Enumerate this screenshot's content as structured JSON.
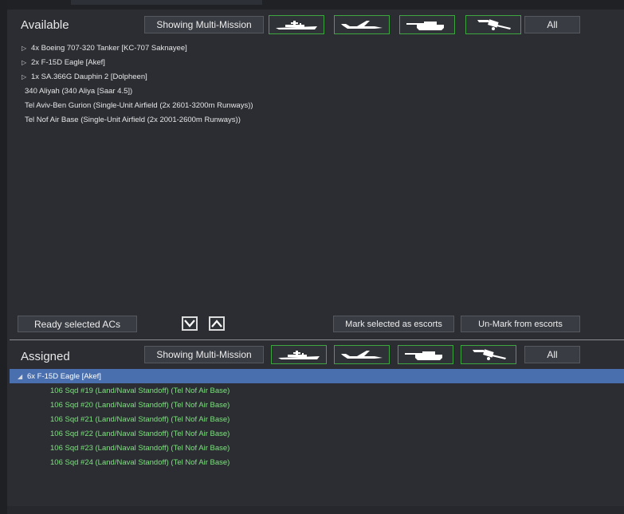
{
  "available": {
    "title": "Available",
    "filter_button": "Showing Multi-Mission",
    "type_filters": [
      {
        "name": "ship-filter-icon"
      },
      {
        "name": "aircraft-filter-icon"
      },
      {
        "name": "tank-filter-icon"
      },
      {
        "name": "satellite-filter-icon"
      }
    ],
    "all_button": "All",
    "items": [
      {
        "label": "4x Boeing 707-320 Tanker [KC-707 Saknayee]",
        "expandable": true
      },
      {
        "label": "2x F-15D Eagle [Akef]",
        "expandable": true
      },
      {
        "label": "1x SA.366G Dauphin 2 [Dolpheen]",
        "expandable": true
      },
      {
        "label": "340 Aliyah (340 Aliya [Saar 4.5])",
        "expandable": false
      },
      {
        "label": "Tel Aviv-Ben Gurion (Single-Unit Airfield (2x 2601-3200m Runways))",
        "expandable": false
      },
      {
        "label": "Tel Nof Air Base (Single-Unit Airfield (2x 2001-2600m Runways))",
        "expandable": false
      }
    ]
  },
  "toolbar": {
    "ready_button": "Ready selected ACs",
    "down_icon": "chevron-down-icon",
    "up_icon": "chevron-up-icon",
    "mark_escorts_button": "Mark selected as escorts",
    "unmark_escorts_button": "Un-Mark from escorts"
  },
  "assigned": {
    "title": "Assigned",
    "filter_button": "Showing Multi-Mission",
    "all_button": "All",
    "group": {
      "label": "6x F-15D Eagle [Akef]",
      "expanded": true
    },
    "children": [
      "106 Sqd #19 (Land/Naval Standoff) (Tel Nof Air Base)",
      "106 Sqd #20 (Land/Naval Standoff) (Tel Nof Air Base)",
      "106 Sqd #21 (Land/Naval Standoff) (Tel Nof Air Base)",
      "106 Sqd #22 (Land/Naval Standoff) (Tel Nof Air Base)",
      "106 Sqd #23 (Land/Naval Standoff) (Tel Nof Air Base)",
      "106 Sqd #24 (Land/Naval Standoff) (Tel Nof Air Base)"
    ]
  },
  "colors": {
    "background": "#2b2d33",
    "selection": "#4a6fae",
    "assigned_text": "#7fe07f",
    "filter_border": "#3ea63e"
  }
}
